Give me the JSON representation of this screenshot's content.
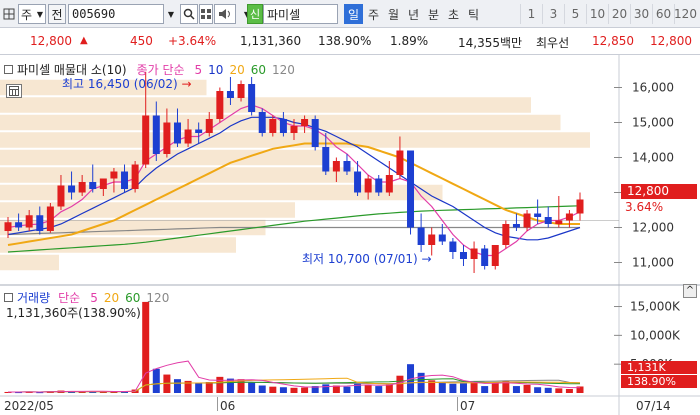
{
  "toolbar": {
    "market_type": "주",
    "code_label": "전",
    "code": "005690",
    "stock_name": "파미셀",
    "stock_badge": "신",
    "periods": [
      "일",
      "주",
      "월",
      "년",
      "분",
      "초",
      "틱"
    ],
    "active_period": "일",
    "intervals": [
      "1",
      "3",
      "5",
      "10",
      "20",
      "30",
      "60",
      "120"
    ]
  },
  "quote": {
    "price": "12,800",
    "change": "450",
    "change_pct": "+3.64%",
    "volume": "1,131,360",
    "volume_ratio": "138.90%",
    "turnover": "1.89%",
    "trade_value": "14,355백만",
    "best_ask_label": "최우선",
    "best_ask": "12,850",
    "best_bid": "12,800"
  },
  "price_panel": {
    "legend_name": "파미셀 매물대 소(10)",
    "ma_legend_title": "종가 단순",
    "ma_periods": [
      "5",
      "10",
      "20",
      "60",
      "120"
    ],
    "ma_colors": [
      "#e23da8",
      "#1a36c8",
      "#f0a814",
      "#2a9a2a",
      "#888888"
    ],
    "high_note": "최고 16,450 (06/02)",
    "low_note": "최저 10,700 (07/01)",
    "y_ticks": [
      "16,000",
      "15,000",
      "14,000",
      "13,000",
      "12,000",
      "11,000"
    ],
    "last_price_tag": "12,800",
    "last_pct_tag": "3.64%"
  },
  "volume_panel": {
    "legend_name": "거래량",
    "ma_legend_title": "단순",
    "ma_periods": [
      "5",
      "20",
      "60",
      "120"
    ],
    "ma_colors": [
      "#e23da8",
      "#f0a814",
      "#2a9a2a",
      "#888888"
    ],
    "summary": "1,131,360주(138.90%)",
    "y_ticks": [
      "15,000K",
      "10,000K",
      "5,000K"
    ],
    "last_vol_tag": "1,131K",
    "last_pct_tag": "138.90%"
  },
  "x_axis": {
    "labels": [
      "2022/05",
      "06",
      "07",
      "07/14"
    ]
  },
  "chart_data": {
    "type": "candlestick",
    "title": "파미셀",
    "ylim": [
      10500,
      16700
    ],
    "ohlc": [
      {
        "o": 11900,
        "h": 12300,
        "l": 11700,
        "c": 12150
      },
      {
        "o": 12150,
        "h": 12400,
        "l": 11900,
        "c": 12000
      },
      {
        "o": 12000,
        "h": 12500,
        "l": 11900,
        "c": 12350
      },
      {
        "o": 12350,
        "h": 12600,
        "l": 11800,
        "c": 11900
      },
      {
        "o": 11900,
        "h": 12700,
        "l": 11850,
        "c": 12600
      },
      {
        "o": 12600,
        "h": 13500,
        "l": 12500,
        "c": 13200
      },
      {
        "o": 13200,
        "h": 13600,
        "l": 12800,
        "c": 13000
      },
      {
        "o": 13000,
        "h": 13500,
        "l": 12900,
        "c": 13300
      },
      {
        "o": 13300,
        "h": 13800,
        "l": 13000,
        "c": 13100
      },
      {
        "o": 13100,
        "h": 13400,
        "l": 12900,
        "c": 13400
      },
      {
        "o": 13400,
        "h": 13700,
        "l": 13000,
        "c": 13600
      },
      {
        "o": 13600,
        "h": 13800,
        "l": 13000,
        "c": 13100
      },
      {
        "o": 13100,
        "h": 13900,
        "l": 13000,
        "c": 13800
      },
      {
        "o": 13800,
        "h": 16450,
        "l": 13700,
        "c": 15200
      },
      {
        "o": 15200,
        "h": 15600,
        "l": 13900,
        "c": 14100
      },
      {
        "o": 14100,
        "h": 15400,
        "l": 14000,
        "c": 15000
      },
      {
        "o": 15000,
        "h": 15400,
        "l": 14300,
        "c": 14400
      },
      {
        "o": 14400,
        "h": 15100,
        "l": 14300,
        "c": 14800
      },
      {
        "o": 14800,
        "h": 15000,
        "l": 14400,
        "c": 14700
      },
      {
        "o": 14700,
        "h": 15300,
        "l": 14600,
        "c": 15100
      },
      {
        "o": 15100,
        "h": 16000,
        "l": 15000,
        "c": 15900
      },
      {
        "o": 15900,
        "h": 16300,
        "l": 15500,
        "c": 15700
      },
      {
        "o": 15700,
        "h": 16200,
        "l": 15600,
        "c": 16100
      },
      {
        "o": 16100,
        "h": 16300,
        "l": 15200,
        "c": 15300
      },
      {
        "o": 15300,
        "h": 15400,
        "l": 14600,
        "c": 14700
      },
      {
        "o": 14700,
        "h": 15200,
        "l": 14600,
        "c": 15100
      },
      {
        "o": 15100,
        "h": 15300,
        "l": 14600,
        "c": 14700
      },
      {
        "o": 14700,
        "h": 15100,
        "l": 14500,
        "c": 14900
      },
      {
        "o": 14900,
        "h": 15200,
        "l": 14700,
        "c": 15100
      },
      {
        "o": 15100,
        "h": 15200,
        "l": 14200,
        "c": 14300
      },
      {
        "o": 14300,
        "h": 14700,
        "l": 13500,
        "c": 13600
      },
      {
        "o": 13600,
        "h": 14000,
        "l": 13300,
        "c": 13900
      },
      {
        "o": 13900,
        "h": 14100,
        "l": 13500,
        "c": 13600
      },
      {
        "o": 13600,
        "h": 13900,
        "l": 12900,
        "c": 13000
      },
      {
        "o": 13000,
        "h": 13500,
        "l": 12800,
        "c": 13400
      },
      {
        "o": 13400,
        "h": 13500,
        "l": 12900,
        "c": 13000
      },
      {
        "o": 13000,
        "h": 13900,
        "l": 12900,
        "c": 13500
      },
      {
        "o": 13500,
        "h": 14600,
        "l": 13400,
        "c": 14200
      },
      {
        "o": 14200,
        "h": 14200,
        "l": 11800,
        "c": 12000
      },
      {
        "o": 12000,
        "h": 12400,
        "l": 11300,
        "c": 11500
      },
      {
        "o": 11500,
        "h": 12000,
        "l": 11200,
        "c": 11800
      },
      {
        "o": 11800,
        "h": 12100,
        "l": 11500,
        "c": 11600
      },
      {
        "o": 11600,
        "h": 11700,
        "l": 11100,
        "c": 11300
      },
      {
        "o": 11300,
        "h": 11500,
        "l": 10900,
        "c": 11100
      },
      {
        "o": 11100,
        "h": 11600,
        "l": 10700,
        "c": 11400
      },
      {
        "o": 11400,
        "h": 11500,
        "l": 10800,
        "c": 10900
      },
      {
        "o": 10900,
        "h": 11500,
        "l": 10800,
        "c": 11500
      },
      {
        "o": 11500,
        "h": 12200,
        "l": 11400,
        "c": 12100
      },
      {
        "o": 12100,
        "h": 12400,
        "l": 11900,
        "c": 12000
      },
      {
        "o": 12000,
        "h": 12500,
        "l": 11900,
        "c": 12400
      },
      {
        "o": 12400,
        "h": 12800,
        "l": 12100,
        "c": 12300
      },
      {
        "o": 12300,
        "h": 12600,
        "l": 12000,
        "c": 12100
      },
      {
        "o": 12100,
        "h": 12900,
        "l": 12000,
        "c": 12200
      },
      {
        "o": 12200,
        "h": 12500,
        "l": 12000,
        "c": 12400
      },
      {
        "o": 12400,
        "h": 13000,
        "l": 12200,
        "c": 12800
      }
    ],
    "volume_k": [
      180,
      160,
      220,
      150,
      300,
      420,
      260,
      280,
      240,
      250,
      300,
      230,
      600,
      15800,
      4200,
      3200,
      2400,
      2100,
      1700,
      1900,
      2800,
      2500,
      2400,
      1900,
      1300,
      1100,
      1000,
      900,
      950,
      1200,
      1500,
      1300,
      1100,
      1700,
      1400,
      1200,
      1500,
      3000,
      5000,
      3500,
      2200,
      1800,
      1600,
      1700,
      2000,
      1200,
      1900,
      2100,
      1200,
      1400,
      1000,
      900,
      800,
      700,
      1131
    ],
    "ma5": [
      12000,
      12050,
      12080,
      12100,
      12200,
      12450,
      12600,
      12800,
      13100,
      13200,
      13300,
      13300,
      13400,
      13900,
      14100,
      14300,
      14500,
      14600,
      14600,
      14800,
      15000,
      15200,
      15400,
      15500,
      15400,
      15200,
      15000,
      14900,
      14900,
      14800,
      14600,
      14300,
      14100,
      13800,
      13500,
      13300,
      13300,
      13400,
      13300,
      12900,
      12600,
      12200,
      11800,
      11500,
      11300,
      11200,
      11200,
      11400,
      11600,
      11900,
      12100,
      12200,
      12200,
      12300,
      12450
    ],
    "ma10": [
      11800,
      11850,
      11900,
      11950,
      12000,
      12100,
      12250,
      12400,
      12550,
      12700,
      12850,
      13000,
      13150,
      13450,
      13700,
      13900,
      14100,
      14250,
      14400,
      14550,
      14700,
      14900,
      15050,
      15150,
      15150,
      15150,
      15100,
      15000,
      14950,
      14850,
      14750,
      14600,
      14450,
      14300,
      14100,
      13900,
      13700,
      13500,
      13300,
      13100,
      12900,
      12750,
      12600,
      12400,
      12200,
      12000,
      11850,
      11750,
      11700,
      11650,
      11650,
      11700,
      11800,
      11900,
      12000
    ],
    "ma20": [
      11500,
      11550,
      11600,
      11650,
      11700,
      11750,
      11800,
      11900,
      12000,
      12100,
      12200,
      12350,
      12500,
      12650,
      12800,
      12950,
      13100,
      13250,
      13400,
      13550,
      13700,
      13850,
      13950,
      14050,
      14150,
      14250,
      14300,
      14350,
      14400,
      14400,
      14400,
      14400,
      14400,
      14350,
      14300,
      14200,
      14100,
      14000,
      13850,
      13700,
      13550,
      13400,
      13250,
      13100,
      12950,
      12800,
      12650,
      12500,
      12400,
      12300,
      12200,
      12150,
      12100,
      12100,
      12100
    ],
    "ma60": [
      11300,
      11320,
      11340,
      11360,
      11380,
      11400,
      11420,
      11440,
      11460,
      11480,
      11500,
      11520,
      11550,
      11580,
      11620,
      11660,
      11700,
      11740,
      11780,
      11820,
      11860,
      11900,
      11940,
      11980,
      12020,
      12060,
      12100,
      12140,
      12180,
      12210,
      12240,
      12270,
      12300,
      12330,
      12360,
      12390,
      12410,
      12430,
      12450,
      12470,
      12480,
      12490,
      12500,
      12510,
      12520,
      12530,
      12540,
      12550,
      12560,
      12570,
      12580,
      12590,
      12600,
      12610,
      12620
    ],
    "ma120": [
      11800,
      11810,
      11820,
      11830,
      11840,
      11850,
      11860,
      11870,
      11880,
      11890,
      11900,
      11910,
      11920,
      11930,
      11940,
      11950,
      11960,
      11970,
      11980,
      11990,
      12000,
      12000,
      12000,
      12000,
      12000,
      12000,
      12000,
      12000,
      12000,
      12000,
      12000,
      12000,
      12000,
      12000,
      12000,
      12000,
      12000,
      12000,
      12000,
      12000,
      12000,
      12000,
      12000,
      12000,
      12000,
      12000,
      12000,
      12000,
      12000,
      12000,
      12000,
      12000,
      12000,
      12000,
      12000
    ],
    "volume_profile": [
      {
        "price": 16000,
        "weight": 0.35
      },
      {
        "price": 15500,
        "weight": 0.9
      },
      {
        "price": 15000,
        "weight": 0.95
      },
      {
        "price": 14500,
        "weight": 1.0
      },
      {
        "price": 14000,
        "weight": 0.55
      },
      {
        "price": 13500,
        "weight": 0.6
      },
      {
        "price": 13000,
        "weight": 0.75
      },
      {
        "price": 12500,
        "weight": 0.5
      },
      {
        "price": 12000,
        "weight": 0.45
      },
      {
        "price": 11500,
        "weight": 0.4
      },
      {
        "price": 11000,
        "weight": 0.1
      }
    ],
    "volume_ylim": [
      0,
      17000
    ],
    "colors": {
      "up": "#e01e1e",
      "down": "#1d3fd1",
      "profile": "#f7e7d2"
    }
  }
}
